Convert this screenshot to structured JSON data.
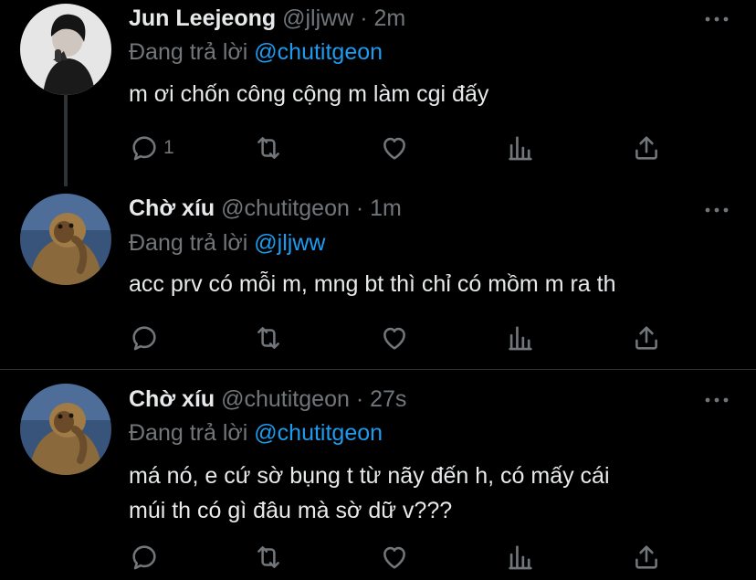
{
  "tweets": [
    {
      "name": "Jun Leejeong",
      "handle": "@jljww",
      "sep": "·",
      "time": "2m",
      "replying_prefix": "Đang trả lời",
      "replying_to": "@chutitgeon",
      "lines": [
        "m ơi chốn công cộng m làm cgi đấy"
      ],
      "reply_count": "1"
    },
    {
      "name": "Chờ xíu",
      "handle": "@chutitgeon",
      "sep": "·",
      "time": "1m",
      "replying_prefix": "Đang trả lời",
      "replying_to": "@jljww",
      "lines": [
        "acc prv có mỗi m, mng bt thì chỉ có mồm m ra th"
      ],
      "reply_count": ""
    },
    {
      "name": "Chờ xíu",
      "handle": "@chutitgeon",
      "sep": "·",
      "time": "27s",
      "replying_prefix": "Đang trả lời",
      "replying_to": "@chutitgeon",
      "lines": [
        "má nó, e cứ sờ bụng t từ nãy đến h, có mấy cái",
        "múi th có gì đâu mà sờ dữ v???"
      ],
      "reply_count": ""
    }
  ],
  "colors": {
    "background": "#000000",
    "text": "#e7e9ea",
    "muted": "#71767b",
    "link": "#1d9bf0",
    "line": "#2f3336"
  },
  "icons": [
    "more-icon",
    "reply-icon",
    "retweet-icon",
    "like-icon",
    "analytics-icon",
    "share-icon"
  ]
}
